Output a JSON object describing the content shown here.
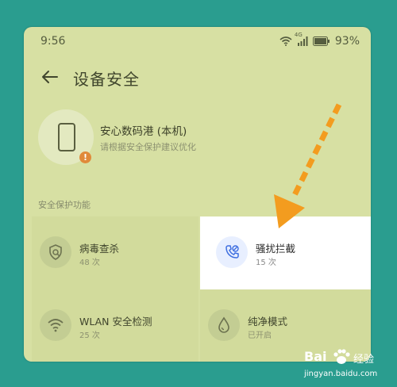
{
  "status_bar": {
    "time": "9:56",
    "network_label": "4G",
    "battery": "93%"
  },
  "header": {
    "title": "设备安全"
  },
  "device": {
    "name": "安心数码港 (本机)",
    "subtitle": "请根据安全保护建议优化",
    "alert_badge": "!"
  },
  "section": {
    "title": "安全保护功能"
  },
  "features": [
    {
      "title": "病毒查杀",
      "sub": "48 次",
      "icon": "shield-search-icon"
    },
    {
      "title": "骚扰拦截",
      "sub": "15 次",
      "icon": "phone-block-icon"
    },
    {
      "title": "WLAN 安全检测",
      "sub": "25 次",
      "icon": "wifi-icon"
    },
    {
      "title": "纯净模式",
      "sub": "已开启",
      "icon": "drop-icon"
    }
  ],
  "watermark": {
    "brand": "Bai",
    "brand_suffix": "经验",
    "domain": "jingyan.baidu.com"
  },
  "colors": {
    "overlay_bg": "#2a9d8f",
    "phone_bg": "#d7e0a3",
    "arrow": "#f39c1f",
    "highlight_bg": "#ffffff",
    "alert_badge": "#e08a3a",
    "accent_blue": "#3f6fe0"
  }
}
